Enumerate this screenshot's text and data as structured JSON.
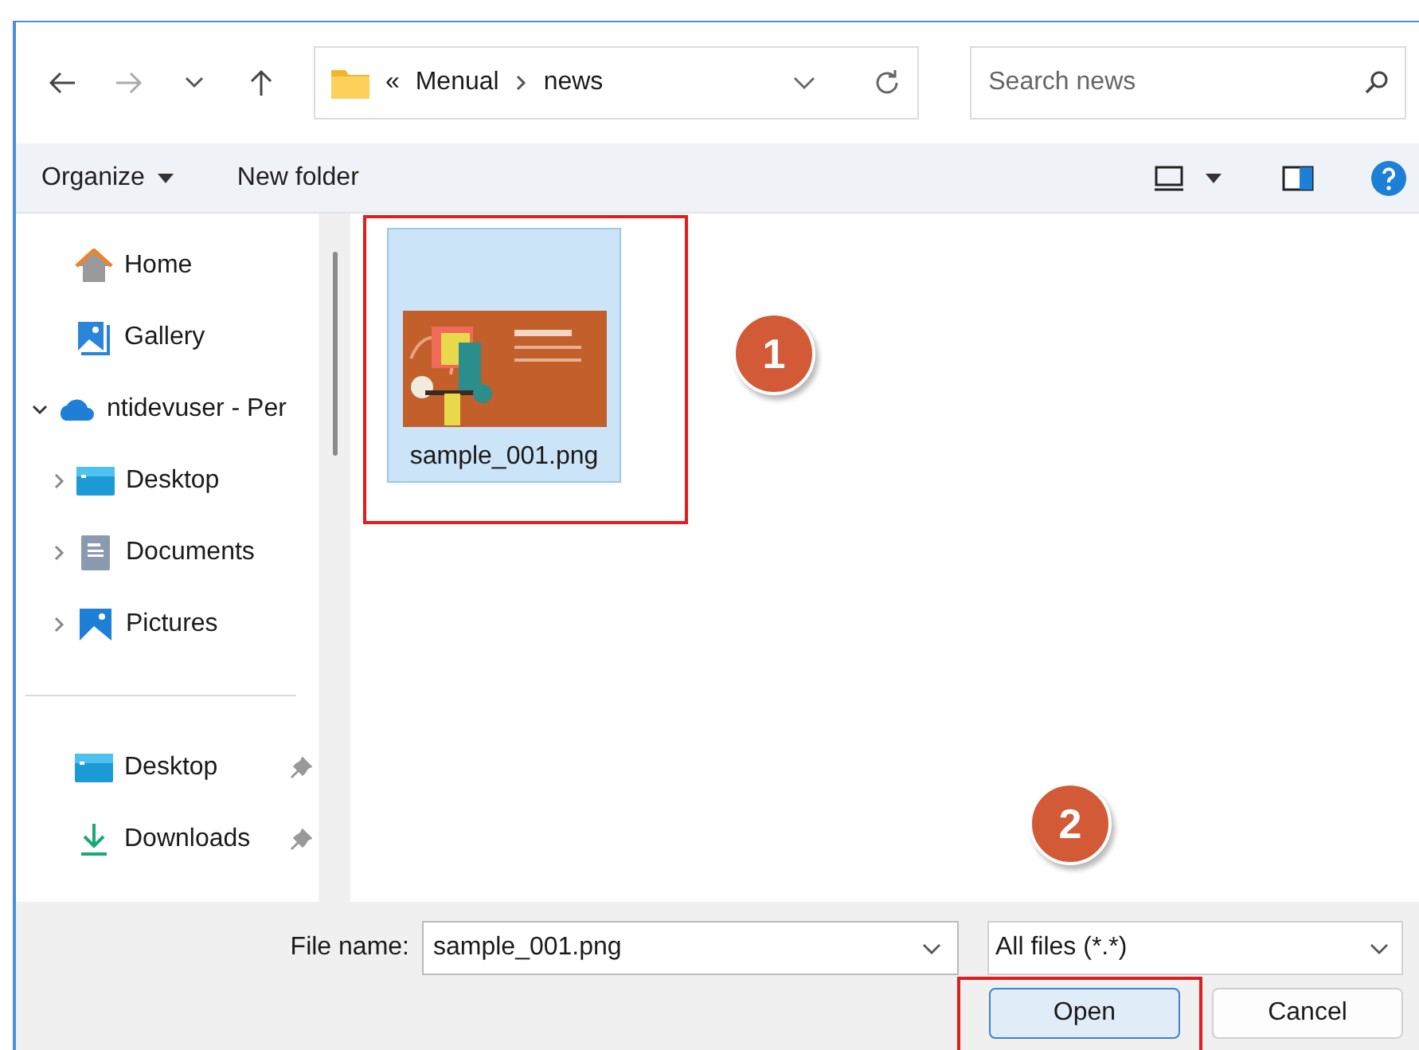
{
  "nav": {
    "overflow": "«",
    "path": [
      {
        "label": "Menual"
      },
      {
        "label": "news"
      }
    ],
    "search": {
      "placeholder": "Search news"
    }
  },
  "toolbar": {
    "organize": "Organize",
    "new_folder": "New folder"
  },
  "sidebar": {
    "top": [
      {
        "kind": "home",
        "label": "Home"
      },
      {
        "kind": "gallery",
        "label": "Gallery"
      },
      {
        "kind": "cloud",
        "label": "ntidevuser - Per",
        "expanded": true,
        "children": [
          {
            "kind": "desktop",
            "label": "Desktop",
            "expanded": false
          },
          {
            "kind": "documents",
            "label": "Documents",
            "expanded": false
          },
          {
            "kind": "pictures",
            "label": "Pictures",
            "expanded": false
          }
        ]
      }
    ],
    "pinned": [
      {
        "kind": "desktop",
        "label": "Desktop",
        "pinned": true
      },
      {
        "kind": "downloads",
        "label": "Downloads",
        "pinned": true
      }
    ]
  },
  "files": [
    {
      "name": "sample_001.png",
      "kind": "picture",
      "selected": true
    }
  ],
  "footer": {
    "file_name_label": "File name:",
    "file_name": "sample_001.png",
    "filter": "All files (*.*)",
    "buttons": [
      {
        "label": "Open",
        "default": true
      },
      {
        "label": "Cancel",
        "default": false
      }
    ]
  },
  "annotations": [
    {
      "label": "1"
    },
    {
      "label": "2"
    }
  ]
}
